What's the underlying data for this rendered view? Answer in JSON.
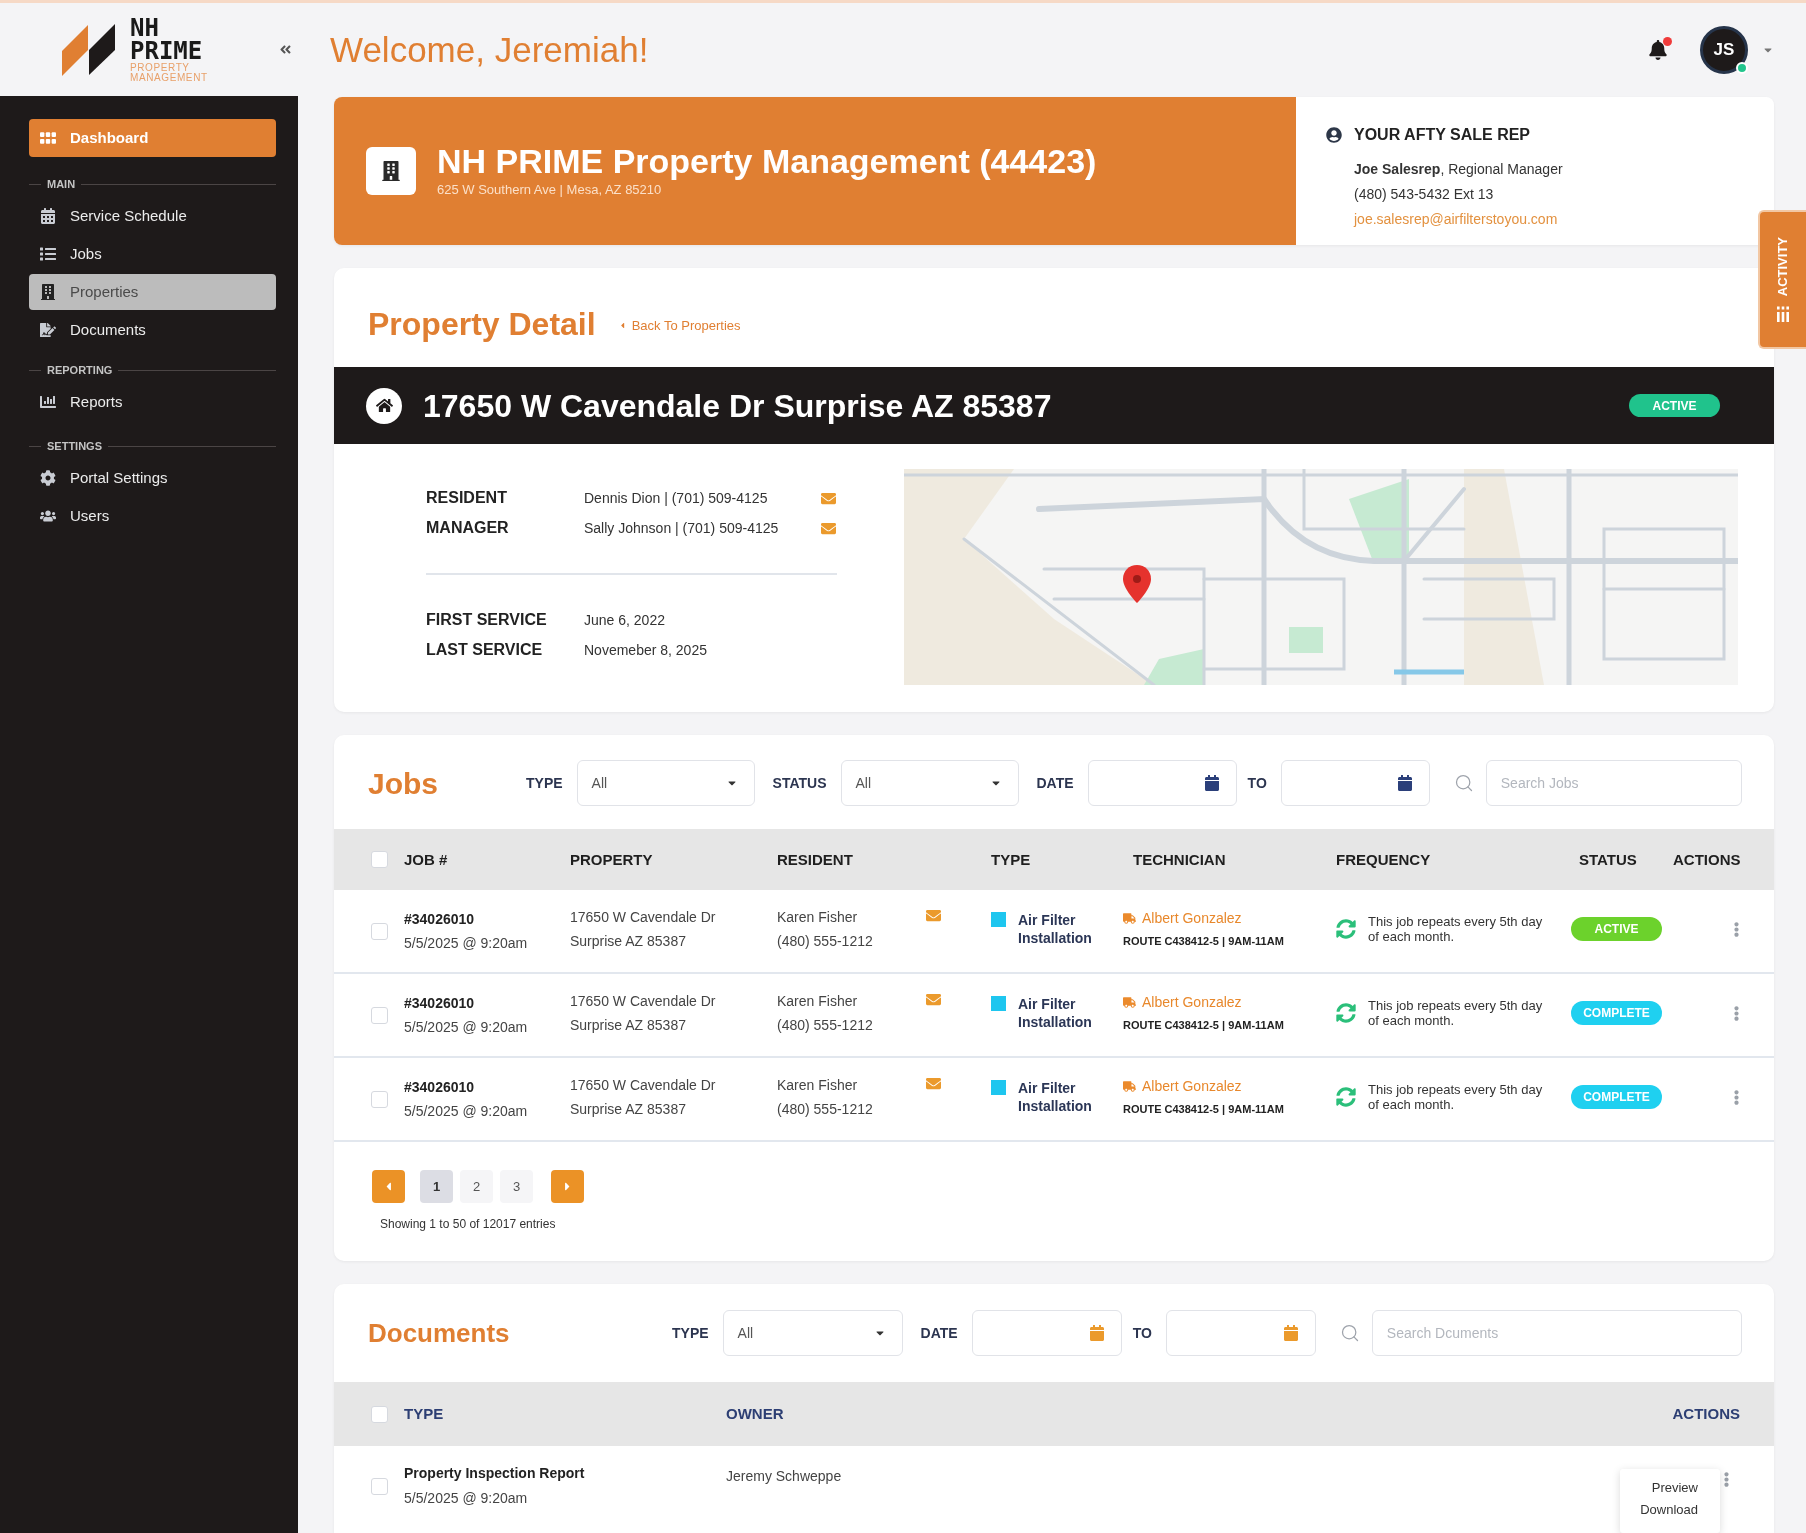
{
  "logo": {
    "name": [
      "NH",
      "PRIME"
    ],
    "tagline": [
      "PROPERTY",
      "MANAGEMENT"
    ]
  },
  "top_bar": {
    "welcome": "Welcome, Jeremiah!",
    "notifications": {
      "unread": true
    },
    "user": {
      "initials": "JS",
      "online": true
    }
  },
  "sidebar": {
    "dashboard": {
      "label": "Dashboard"
    },
    "sections": [
      {
        "title": "MAIN",
        "items": [
          {
            "label": "Service Schedule",
            "selected": false
          },
          {
            "label": "Jobs",
            "selected": false
          },
          {
            "label": "Properties",
            "selected": true
          },
          {
            "label": "Documents",
            "selected": false
          }
        ]
      },
      {
        "title": "REPORTING",
        "items": [
          {
            "label": "Reports",
            "selected": false
          }
        ]
      },
      {
        "title": "SETTINGS",
        "items": [
          {
            "label": "Portal Settings",
            "selected": false
          },
          {
            "label": "Users",
            "selected": false
          }
        ]
      }
    ]
  },
  "company": {
    "name": "NH PRIME Property Management (44423)",
    "address": "625 W Southern Ave | Mesa, AZ 85210"
  },
  "sales_rep": {
    "heading": "YOUR AFTY SALE REP",
    "name_line": "**Joe Salesrep**, Regional Manager",
    "phone": "(480) 543-5432 Ext 13",
    "email": "joe.salesrep@airfilterstoyou.com"
  },
  "activity_tab": {
    "label": "ACTIVITY"
  },
  "property_detail": {
    "title": "Property Detail",
    "back_link": "Back To Properties",
    "address": "17650 W Cavendale Dr Surprise AZ 85387",
    "status": "ACTIVE",
    "contacts": [
      {
        "label": "RESIDENT",
        "value": "Dennis Dion | (701) 509-4125"
      },
      {
        "label": "MANAGER",
        "value": "Sally Johnson | (701) 509-4125"
      }
    ],
    "service_dates": [
      {
        "label": "FIRST SERVICE",
        "value": "June 6, 2022"
      },
      {
        "label": "LAST SERVICE",
        "value": "Novemeber 8, 2025"
      }
    ]
  },
  "jobs": {
    "title": "Jobs",
    "filters": [
      {
        "label": "TYPE",
        "kind": "select",
        "value": "All"
      },
      {
        "label": "STATUS",
        "kind": "select",
        "value": "All"
      },
      {
        "label": "DATE",
        "kind": "date"
      },
      {
        "label": "TO",
        "kind": "date"
      }
    ],
    "search": {
      "placeholder": "Search Jobs"
    },
    "table": {
      "select_all": {
        "checked": false
      },
      "columns": [
        "JOB #",
        "PROPERTY",
        "RESIDENT",
        "TYPE",
        "TECHNICIAN",
        "FREQUENCY",
        "STATUS",
        "ACTIONS"
      ],
      "rows": [
        {
          "checked": false,
          "job_number": "#34026010",
          "date": "5/5/2025 @ 9:20am",
          "property": {
            "street": "17650 W Cavendale Dr",
            "city": "Surprise AZ 85387"
          },
          "resident": {
            "name": "Karen Fisher",
            "phone": "(480) 555-1212"
          },
          "type": {
            "label": "Air Filter Installation",
            "color": "#1ec6ef"
          },
          "technician": {
            "name": "Albert Gonzalez",
            "route": "ROUTE C438412-5 | 9AM-11AM"
          },
          "frequency": "This job repeats every 5th day of each month.",
          "status": {
            "label": "ACTIVE",
            "color": "#6cd22c"
          }
        },
        {
          "checked": false,
          "job_number": "#34026010",
          "date": "5/5/2025 @ 9:20am",
          "property": {
            "street": "17650 W Cavendale Dr",
            "city": "Surprise AZ 85387"
          },
          "resident": {
            "name": "Karen Fisher",
            "phone": "(480) 555-1212"
          },
          "type": {
            "label": "Air Filter Installation",
            "color": "#1ec6ef"
          },
          "technician": {
            "name": "Albert Gonzalez",
            "route": "ROUTE C438412-5 | 9AM-11AM"
          },
          "frequency": "This job repeats every 5th day of each month.",
          "status": {
            "label": "COMPLETE",
            "color": "#1fd0f0"
          }
        },
        {
          "checked": false,
          "job_number": "#34026010",
          "date": "5/5/2025 @ 9:20am",
          "property": {
            "street": "17650 W Cavendale Dr",
            "city": "Surprise AZ 85387"
          },
          "resident": {
            "name": "Karen Fisher",
            "phone": "(480) 555-1212"
          },
          "type": {
            "label": "Air Filter Installation",
            "color": "#1ec6ef"
          },
          "technician": {
            "name": "Albert Gonzalez",
            "route": "ROUTE C438412-5 | 9AM-11AM"
          },
          "frequency": "This job repeats every 5th day of each month.",
          "status": {
            "label": "COMPLETE",
            "color": "#1fd0f0"
          }
        }
      ]
    },
    "pagination": {
      "pages": [
        {
          "label": "1",
          "selected": true
        },
        {
          "label": "2",
          "selected": false
        },
        {
          "label": "3",
          "selected": false
        }
      ],
      "summary": "Showing 1 to 50 of 12017 entries"
    }
  },
  "documents": {
    "title": "Documents",
    "filters": [
      {
        "label": "TYPE",
        "kind": "select",
        "value": "All"
      },
      {
        "label": "DATE",
        "kind": "date"
      },
      {
        "label": "TO",
        "kind": "date"
      }
    ],
    "search": {
      "placeholder": "Search Dcuments"
    },
    "table": {
      "select_all": {
        "checked": false
      },
      "columns": [
        "TYPE",
        "OWNER",
        "ACTIONS"
      ],
      "rows": [
        {
          "checked": false,
          "name": "Property Inspection Report",
          "date": "5/5/2025 @ 9:20am",
          "owner": "Jeremy Schweppe",
          "menu": {
            "open": true,
            "items": [
              "Preview",
              "Download"
            ]
          }
        }
      ]
    }
  }
}
